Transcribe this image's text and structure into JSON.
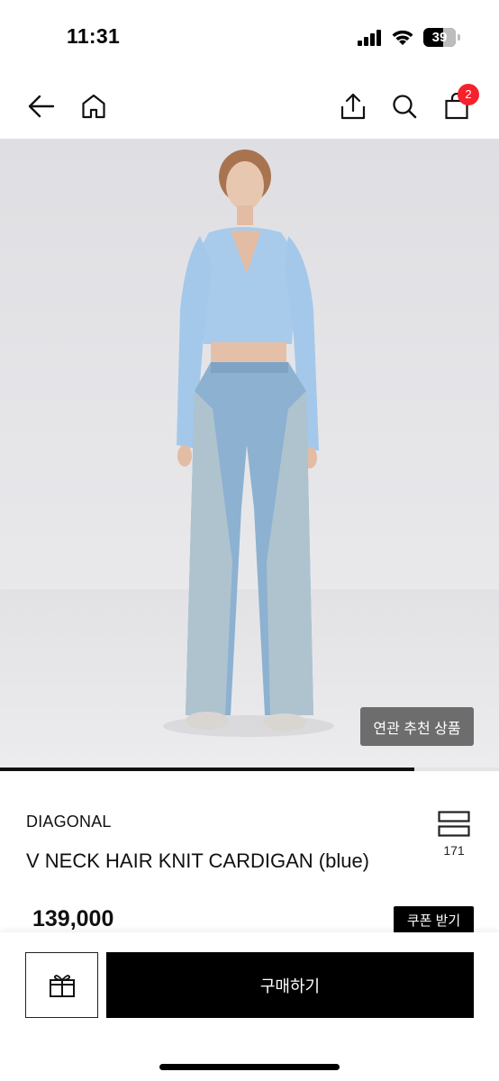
{
  "status_bar": {
    "time": "11:31",
    "battery_level": "39",
    "icons": [
      "signal-icon",
      "wifi-icon",
      "battery-icon"
    ]
  },
  "nav": {
    "icons": [
      "back-arrow-icon",
      "home-icon",
      "share-icon",
      "search-icon",
      "shopping-bag-icon"
    ],
    "cart_count": "2",
    "badge_color": "#f5222d"
  },
  "image": {
    "related_button_label": "연관 추천 상품",
    "carousel_progress": 0.83
  },
  "product": {
    "brand": "DIAGONAL",
    "name": "V NECK HAIR KNIT CARDIGAN (blue)",
    "like_count": "171",
    "price": "139,000",
    "coupon_label": "쿠폰 받기"
  },
  "bottom_bar": {
    "gift_icon": "gift-icon",
    "buy_label": "구매하기"
  }
}
